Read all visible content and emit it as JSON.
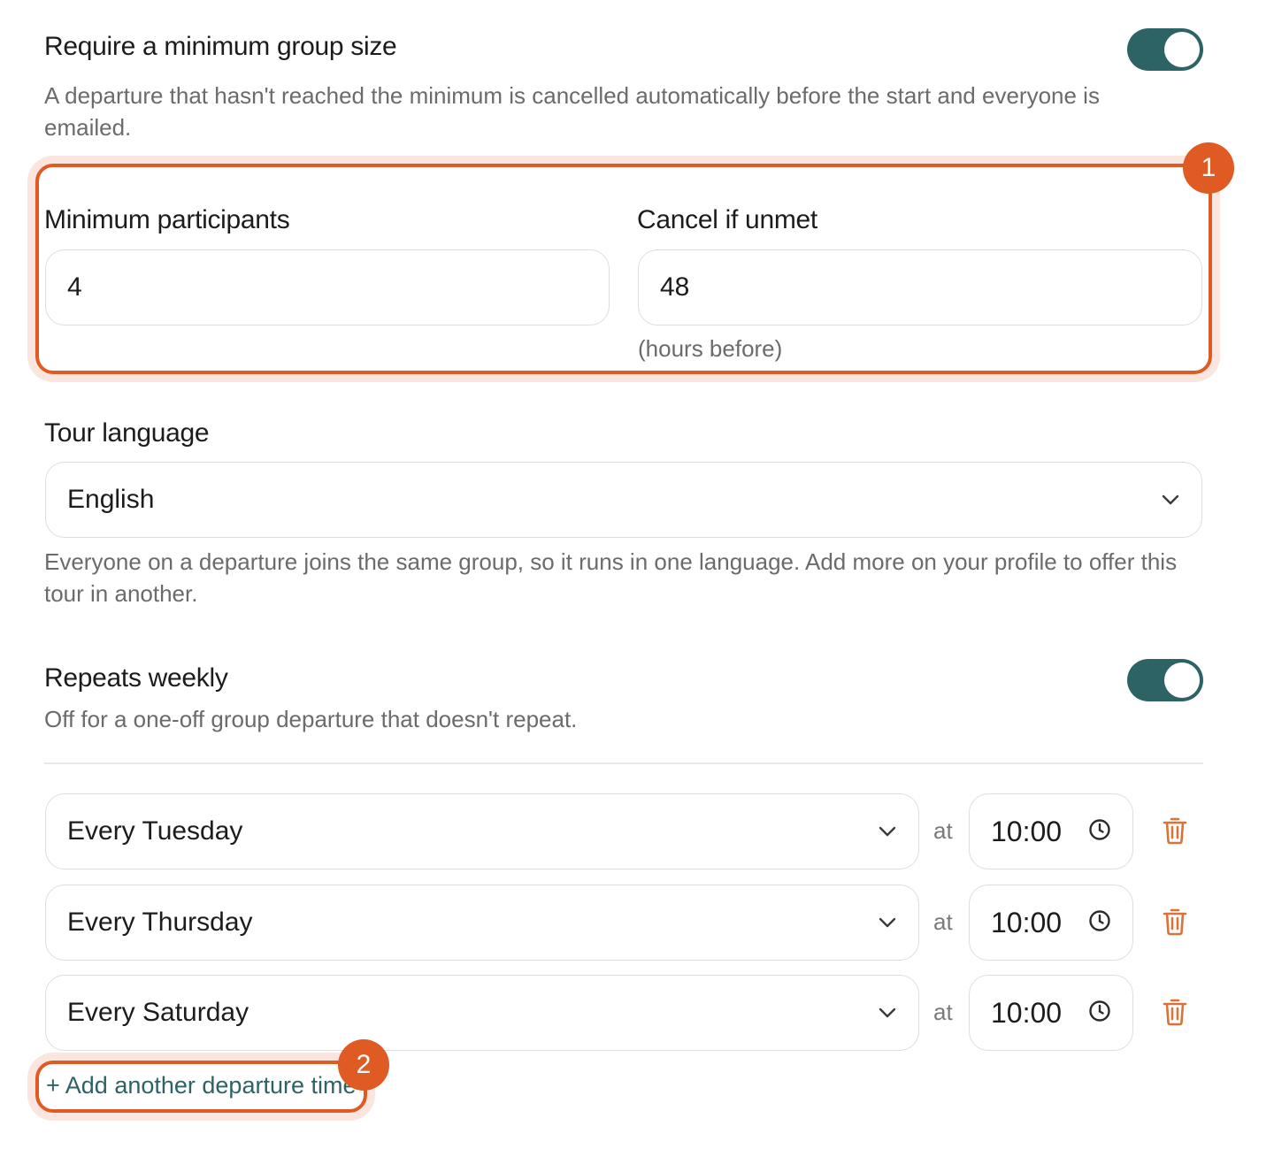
{
  "group_size": {
    "title": "Require a minimum group size",
    "description": "A departure that hasn't reached the minimum is cancelled automatically before the start and everyone is emailed.",
    "toggle_on": true
  },
  "min_participants": {
    "label": "Minimum participants",
    "value": "4"
  },
  "cancel_if_unmet": {
    "label": "Cancel if unmet",
    "value": "48",
    "hint": "(hours before)"
  },
  "tour_language": {
    "label": "Tour language",
    "selected": "English",
    "description": "Everyone on a departure joins the same group, so it runs in one language. Add more on your profile to offer this tour in another."
  },
  "repeats_weekly": {
    "title": "Repeats weekly",
    "description": "Off for a one-off group departure that doesn't repeat.",
    "toggle_on": true
  },
  "departures": [
    {
      "day": "Every Tuesday",
      "at": "at",
      "time": "10:00"
    },
    {
      "day": "Every Thursday",
      "at": "at",
      "time": "10:00"
    },
    {
      "day": "Every Saturday",
      "at": "at",
      "time": "10:00"
    }
  ],
  "add_departure_label": "+ Add another departure time",
  "annotations": {
    "badge1": "1",
    "badge2": "2"
  },
  "colors": {
    "accent": "#2e6366",
    "callout": "#e05a24",
    "trash": "#d9733a"
  }
}
